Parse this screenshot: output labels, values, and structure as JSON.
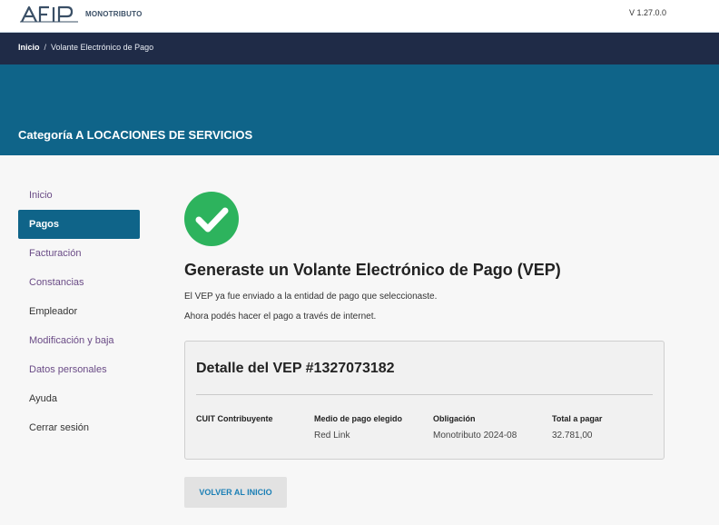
{
  "header": {
    "product_name": "MONOTRIBUTO",
    "version": "V 1.27.0.0"
  },
  "breadcrumb": {
    "home": "Inicio",
    "separator": "/",
    "current": "Volante Electrónico de Pago"
  },
  "banner": {
    "title": "Categoría A LOCACIONES DE SERVICIOS"
  },
  "sidebar": {
    "items": [
      {
        "label": "Inicio"
      },
      {
        "label": "Pagos"
      },
      {
        "label": "Facturación"
      },
      {
        "label": "Constancias"
      },
      {
        "label": "Empleador"
      },
      {
        "label": "Modificación y baja"
      },
      {
        "label": "Datos personales"
      },
      {
        "label": "Ayuda"
      },
      {
        "label": "Cerrar sesión"
      }
    ]
  },
  "main": {
    "heading": "Generaste un Volante Electrónico de Pago (VEP)",
    "line1": "El VEP ya fue enviado a la entidad de pago que seleccionaste.",
    "line2": "Ahora podés hacer el pago a través de internet.",
    "detail": {
      "title": "Detalle del VEP #1327073182",
      "columns": [
        {
          "label": "CUIT Contribuyente",
          "value": ""
        },
        {
          "label": "Medio de pago elegido",
          "value": "Red Link"
        },
        {
          "label": "Obligación",
          "value": "Monotributo 2024-08"
        },
        {
          "label": "Total a pagar",
          "value": "32.781,00"
        }
      ]
    },
    "back_button": "VOLVER AL INICIO"
  },
  "colors": {
    "brand": "#0f6489",
    "nav": "#1f2b47",
    "success": "#2db35d",
    "link": "#1b7fb5"
  }
}
